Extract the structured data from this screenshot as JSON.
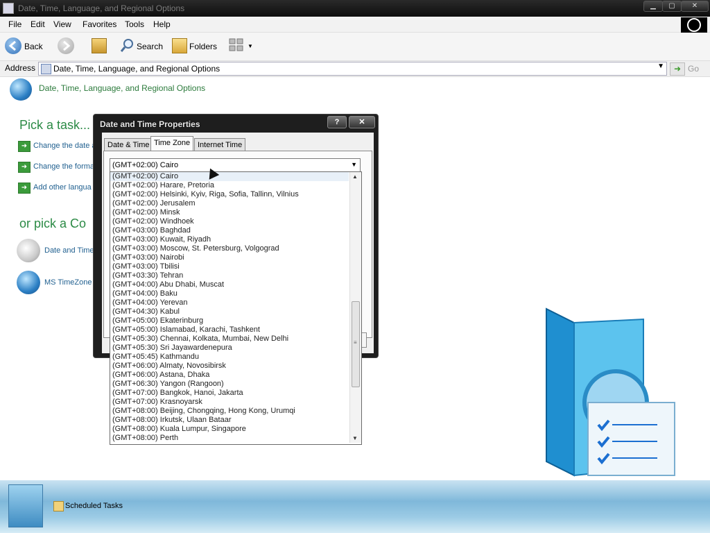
{
  "window": {
    "title": "Date, Time, Language, and Regional Options"
  },
  "menu": [
    "File",
    "Edit",
    "View",
    "Favorites",
    "Tools",
    "Help"
  ],
  "toolbar": {
    "back": "Back",
    "search": "Search",
    "folders": "Folders"
  },
  "address": {
    "label": "Address",
    "value": "Date, Time, Language, and Regional Options",
    "go": "Go"
  },
  "content": {
    "header_title": "Date, Time, Language, and Regional Options",
    "pick_task": "Pick a task...",
    "tasks": [
      "Change the date a",
      "Change the forma",
      "Add other langua"
    ],
    "pick_cp": "or pick a Co",
    "cp_items": [
      "Date and Time",
      "MS TimeZone"
    ]
  },
  "taskbar": {
    "item": "Scheduled Tasks"
  },
  "dialog": {
    "title": "Date and Time Properties",
    "help_btn": "?",
    "close_btn": "✕",
    "tabs": [
      "Date & Time",
      "Time Zone",
      "Internet Time"
    ],
    "active_tab": "Time Zone",
    "selected_zone": "(GMT+02:00) Cairo",
    "zones": [
      "(GMT+02:00) Cairo",
      "(GMT+02:00) Harare, Pretoria",
      "(GMT+02:00) Helsinki, Kyiv, Riga, Sofia, Tallinn, Vilnius",
      "(GMT+02:00) Jerusalem",
      "(GMT+02:00) Minsk",
      "(GMT+02:00) Windhoek",
      "(GMT+03:00) Baghdad",
      "(GMT+03:00) Kuwait, Riyadh",
      "(GMT+03:00) Moscow, St. Petersburg, Volgograd",
      "(GMT+03:00) Nairobi",
      "(GMT+03:00) Tbilisi",
      "(GMT+03:30) Tehran",
      "(GMT+04:00) Abu Dhabi, Muscat",
      "(GMT+04:00) Baku",
      "(GMT+04:00) Yerevan",
      "(GMT+04:30) Kabul",
      "(GMT+05:00) Ekaterinburg",
      "(GMT+05:00) Islamabad, Karachi, Tashkent",
      "(GMT+05:30) Chennai, Kolkata, Mumbai, New Delhi",
      "(GMT+05:30) Sri Jayawardenepura",
      "(GMT+05:45) Kathmandu",
      "(GMT+06:00) Almaty, Novosibirsk",
      "(GMT+06:00) Astana, Dhaka",
      "(GMT+06:30) Yangon (Rangoon)",
      "(GMT+07:00) Bangkok, Hanoi, Jakarta",
      "(GMT+07:00) Krasnoyarsk",
      "(GMT+08:00) Beijing, Chongqing, Hong Kong, Urumqi",
      "(GMT+08:00) Irkutsk, Ulaan Bataar",
      "(GMT+08:00) Kuala Lumpur, Singapore",
      "(GMT+08:00) Perth"
    ]
  },
  "colors": {
    "accent_green": "#2b8a45",
    "link_blue": "#1f5f8f",
    "title_bar": "#111111"
  },
  "icons": [
    "globe-icon",
    "back-icon",
    "forward-icon",
    "up-folder-icon",
    "search-icon",
    "folders-icon",
    "views-icon",
    "task-arrow-icon",
    "clock-icon",
    "timezone-globe-icon"
  ]
}
